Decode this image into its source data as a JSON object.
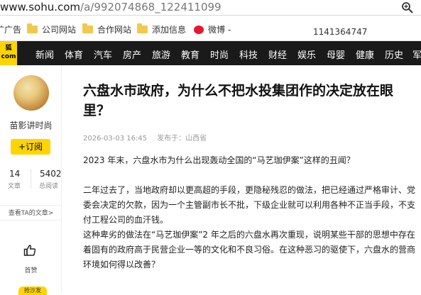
{
  "browser": {
    "url_host": "www.sohu.com",
    "url_path": "/a/992074868_122411099"
  },
  "bookmarks": {
    "items": [
      {
        "label": "扩广告",
        "icon": "partial"
      },
      {
        "label": "公司网站",
        "icon": "folder-icon"
      },
      {
        "label": "合作网站",
        "icon": "folder-icon"
      },
      {
        "label": "添加信息",
        "icon": "folder-icon"
      },
      {
        "label": "微博 -",
        "icon": "weibo-icon"
      }
    ],
    "number": "1141364747"
  },
  "nav": {
    "logo": "狐\ncom",
    "items": [
      "新闻",
      "体育",
      "汽车",
      "房产",
      "旅游",
      "教育",
      "时尚",
      "科技",
      "财经",
      "娱乐",
      "母婴",
      "健康",
      "历史",
      "军"
    ]
  },
  "author": {
    "name": "苗影讲时尚",
    "follow_label": "+订阅",
    "articles_count": "14",
    "articles_label": "文章",
    "reads_count": "5402",
    "reads_label": "总阅读",
    "ta_link": "查看TA的文章>",
    "like_label": "首赞",
    "comment_badge": "抢沙发"
  },
  "article": {
    "title": "六盘水市政府，为什么不把水投集团作的决定放在眼里？",
    "date": "2026-03-03 16:45",
    "source": "发布于：山西省",
    "paragraphs": [
      "2023 年末，六盘水市为什么出现轰动全国的“马艺珈伊案”这样的丑闻？",
      "二年过去了，当地政府却以更高超的手段，更隐秘残忍的做法，把已经通过严格审计、党委会决定的欠款，因为一个主管副市长不批，下级企业就可以利用各种不正当手段，不支付工程公司的血汗钱。",
      "这种卑劣的做法在“马艺珈伊案”2 年之后的六盘水再次重现，说明某些干部的思想中存在着固有的政府高于民营企业一等的文化和不良习俗。在这种恶习的驱使下，六盘水的营商环境如何得以改善？"
    ]
  },
  "colors": {
    "nav_bg": "#1a1a1a",
    "accent_yellow": "#ffd400",
    "meta_gray": "#999999"
  }
}
